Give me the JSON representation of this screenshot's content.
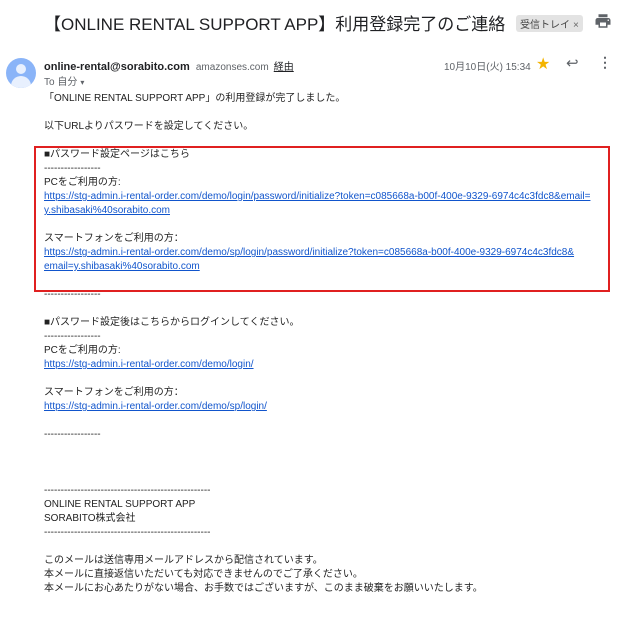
{
  "header": {
    "subject": "【ONLINE RENTAL SUPPORT APP】利用登録完了のご連絡",
    "label": "受信トレイ",
    "label_close": "×"
  },
  "sender": {
    "address": "online-rental@sorabito.com",
    "via_domain": "amazonses.com",
    "via_label": "経由",
    "to_label": "To 自分",
    "caret": "▾",
    "date": "10月10日(火) 15:34"
  },
  "icons": {
    "star": "★",
    "reply": "↩",
    "more": "⋮"
  },
  "body": {
    "line1": "「ONLINE RENTAL SUPPORT APP」の利用登録が完了しました。",
    "line2": "以下URLよりパスワードを設定してください。",
    "pw_heading": "■パスワード設定ページはこちら",
    "sep_short": "-----------------",
    "pc_label": "PCをご利用の方:",
    "pc_link_1": "https://stg-admin.i-rental-order.com/demo/login/password/initialize?token=c085668a-b00f-400e-9329-6974c4c3fdc8&email=",
    "pc_link_2": "y.shibasaki%40sorabito.com",
    "sp_label": "スマートフォンをご利用の方：",
    "sp_link_1": "https://stg-admin.i-rental-order.com/demo/sp/login/password/initialize?token=c085668a-b00f-400e-9329-6974c4c3fdc8&",
    "sp_link_2": "email=y.shibasaki%40sorabito.com",
    "login_heading": "■パスワード設定後はこちらからログインしてください。",
    "pc_login_label": "PCをご利用の方:",
    "pc_login_link": "https://stg-admin.i-rental-order.com/demo/login/",
    "sp_login_label": "スマートフォンをご利用の方：",
    "sp_login_link": "https://stg-admin.i-rental-order.com/demo/sp/login/",
    "sep_long": "--------------------------------------------------",
    "sig_app": "ONLINE RENTAL SUPPORT APP",
    "sig_company": "SORABITO株式会社",
    "footer1": "このメールは送信専用メールアドレスから配信されています。",
    "footer2": "本メールに直接返信いただいても対応できませんのでご了承ください。",
    "footer3": "本メールにお心あたりがない場合、お手数ではございますが、このまま破棄をお願いいたします。"
  }
}
